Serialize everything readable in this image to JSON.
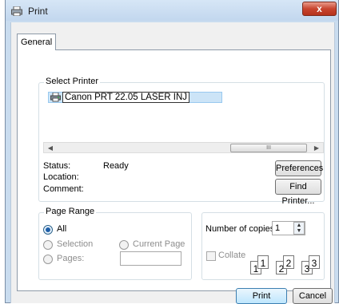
{
  "window": {
    "title": "Print",
    "close_glyph": "x"
  },
  "tabs": [
    {
      "label": "General"
    }
  ],
  "select_printer": {
    "legend": "Select Printer",
    "printers": [
      {
        "name": "Canon PRT 22.05 LASER INJ",
        "icon": "printer-icon"
      }
    ],
    "scroll_grip": "III",
    "status_label": "Status:",
    "status_value": "Ready",
    "location_label": "Location:",
    "comment_label": "Comment:",
    "preferences_button": "Preferences",
    "find_printer_button": "Find Printer..."
  },
  "page_range": {
    "legend": "Page Range",
    "all_label": "All",
    "selection_label": "Selection",
    "current_page_label": "Current Page",
    "pages_label": "Pages:",
    "pages_value": ""
  },
  "copies": {
    "number_label": "Number of copies:",
    "number_value": "1",
    "collate_label": "Collate",
    "collate_pages": [
      "1",
      "1",
      "2",
      "2",
      "3",
      "3"
    ]
  },
  "footer": {
    "print_button": "Print",
    "cancel_button": "Cancel"
  }
}
